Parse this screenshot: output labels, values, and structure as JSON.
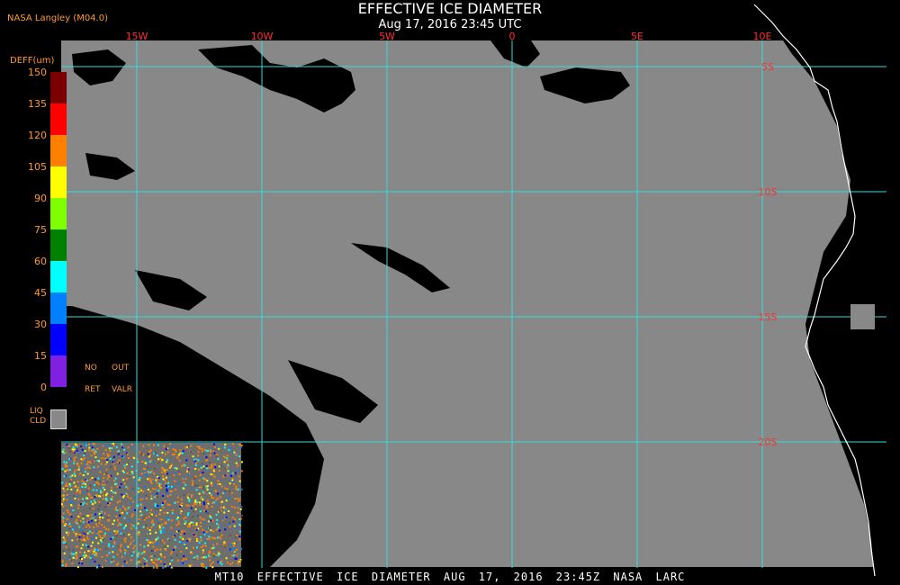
{
  "header": {
    "source": "NASA Langley (M04.0)",
    "title": "EFFECTIVE ICE DIAMETER",
    "subtitle": "Aug 17, 2016 23:45 UTC"
  },
  "footer": {
    "text": "MT10 EFFECTIVE ICE DIAMETER AUG 17, 2016 23:45Z NASA LARC"
  },
  "map": {
    "background_color": "#888888",
    "clear_color": "#000000",
    "grid_color": "#33dddd",
    "coast_color": "#ffffff",
    "lon_labels": [
      "15W",
      "10W",
      "5W",
      "0",
      "5E",
      "10E"
    ],
    "lat_labels": [
      "5S",
      "10S",
      "15S",
      "20S"
    ]
  },
  "legend": {
    "title": "DEFF(um)",
    "ticks": [
      "150",
      "135",
      "120",
      "105",
      "90",
      "75",
      "60",
      "45",
      "30",
      "15",
      "0"
    ],
    "colors": [
      "#7a0000",
      "#ff0000",
      "#ff8000",
      "#ffff00",
      "#80ff00",
      "#008000",
      "#00ffff",
      "#0080ff",
      "#0000ff",
      "#8020e0"
    ],
    "no_ret_top": "NO",
    "no_ret_bottom": "RET",
    "out_top": "OUT",
    "out_bottom": "VALR",
    "liq_top": "LIQ",
    "liq_bottom": "CLD",
    "liq_color": "#888888"
  }
}
